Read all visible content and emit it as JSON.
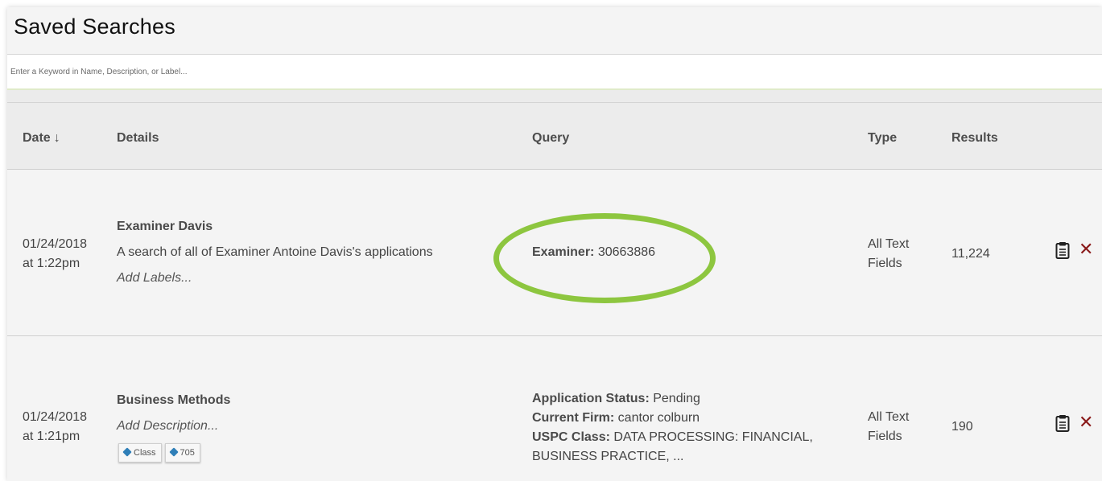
{
  "header": {
    "title": "Saved Searches"
  },
  "search": {
    "placeholder": "Enter a Keyword in Name, Description, or Label..."
  },
  "table": {
    "columns": {
      "date": "Date",
      "details": "Details",
      "query": "Query",
      "type": "Type",
      "results": "Results"
    },
    "sort_arrow": "↓",
    "rows": [
      {
        "date": "01/24/2018",
        "time": "at 1:22pm",
        "name": "Examiner Davis",
        "description": "A search of all of Examiner Antoine Davis's applications",
        "labels_prompt": "Add Labels...",
        "query": [
          {
            "key": "Examiner:",
            "value": " 30663886"
          }
        ],
        "type_line1": "All Text",
        "type_line2": "Fields",
        "results": "11,224"
      },
      {
        "date": "01/24/2018",
        "time": "at 1:21pm",
        "name": "Business Methods",
        "description": "Add Description...",
        "labels": [
          "Class",
          "705"
        ],
        "query": [
          {
            "key": "Application Status:",
            "value": " Pending"
          },
          {
            "key": "Current Firm:",
            "value": " cantor colburn"
          },
          {
            "key": "USPC Class:",
            "value": " DATA PROCESSING: FINANCIAL,"
          }
        ],
        "query_continuation": "BUSINESS PRACTICE, ...",
        "type_line1": "All Text",
        "type_line2": "Fields",
        "results": "190"
      }
    ]
  },
  "icons": {
    "copy": "clipboard-icon",
    "delete": "close-icon",
    "delete_glyph": "✕",
    "tag": "tag-icon"
  },
  "colors": {
    "highlight": "#8dc63f",
    "delete": "#8a1a1a",
    "tag": "#2f7fb8"
  }
}
